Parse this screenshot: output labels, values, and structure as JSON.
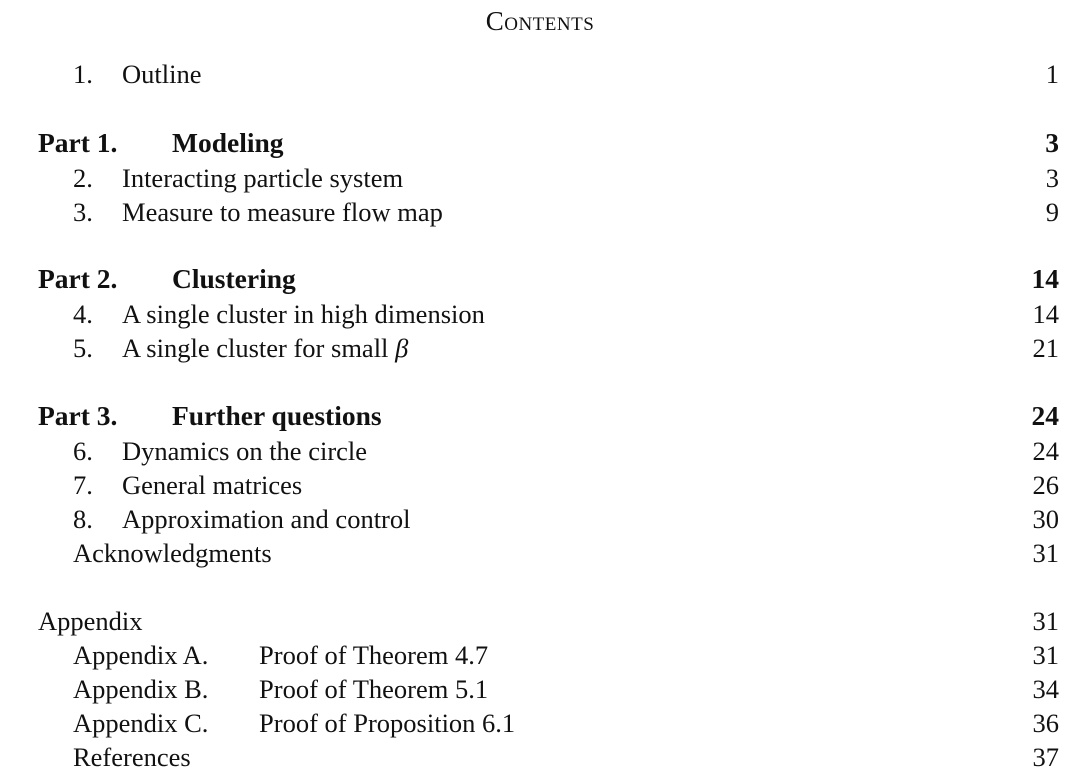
{
  "title": "Contents",
  "entries": [
    {
      "type": "section",
      "num": "1.",
      "label": "Outline",
      "page": "1"
    },
    {
      "type": "part",
      "num": "Part 1.",
      "label": "Modeling",
      "page": "3"
    },
    {
      "type": "section",
      "num": "2.",
      "label": "Interacting particle system",
      "page": "3"
    },
    {
      "type": "section",
      "num": "3.",
      "label": "Measure to measure flow map",
      "page": "9"
    },
    {
      "type": "part",
      "num": "Part 2.",
      "label": "Clustering",
      "page": "14"
    },
    {
      "type": "section",
      "num": "4.",
      "label": "A single cluster in high dimension",
      "page": "14"
    },
    {
      "type": "section",
      "num": "5.",
      "label": "A single cluster for small β",
      "page": "21"
    },
    {
      "type": "part",
      "num": "Part 3.",
      "label": "Further questions",
      "page": "24"
    },
    {
      "type": "section",
      "num": "6.",
      "label": "Dynamics on the circle",
      "page": "24"
    },
    {
      "type": "section",
      "num": "7.",
      "label": "General matrices",
      "page": "26"
    },
    {
      "type": "section",
      "num": "8.",
      "label": "Approximation and control",
      "page": "30"
    },
    {
      "type": "plain",
      "num": "",
      "label": "Acknowledgments",
      "page": "31"
    },
    {
      "type": "appendix-head",
      "num": "",
      "label": "Appendix",
      "page": "31"
    },
    {
      "type": "appx",
      "num": "Appendix A.",
      "label": "Proof of Theorem 4.7",
      "page": "31"
    },
    {
      "type": "appx",
      "num": "Appendix B.",
      "label": "Proof of Theorem 5.1",
      "page": "34"
    },
    {
      "type": "appx",
      "num": "Appendix C.",
      "label": "Proof of Proposition 6.1",
      "page": "36"
    },
    {
      "type": "plain",
      "num": "",
      "label": "References",
      "page": "37"
    }
  ]
}
